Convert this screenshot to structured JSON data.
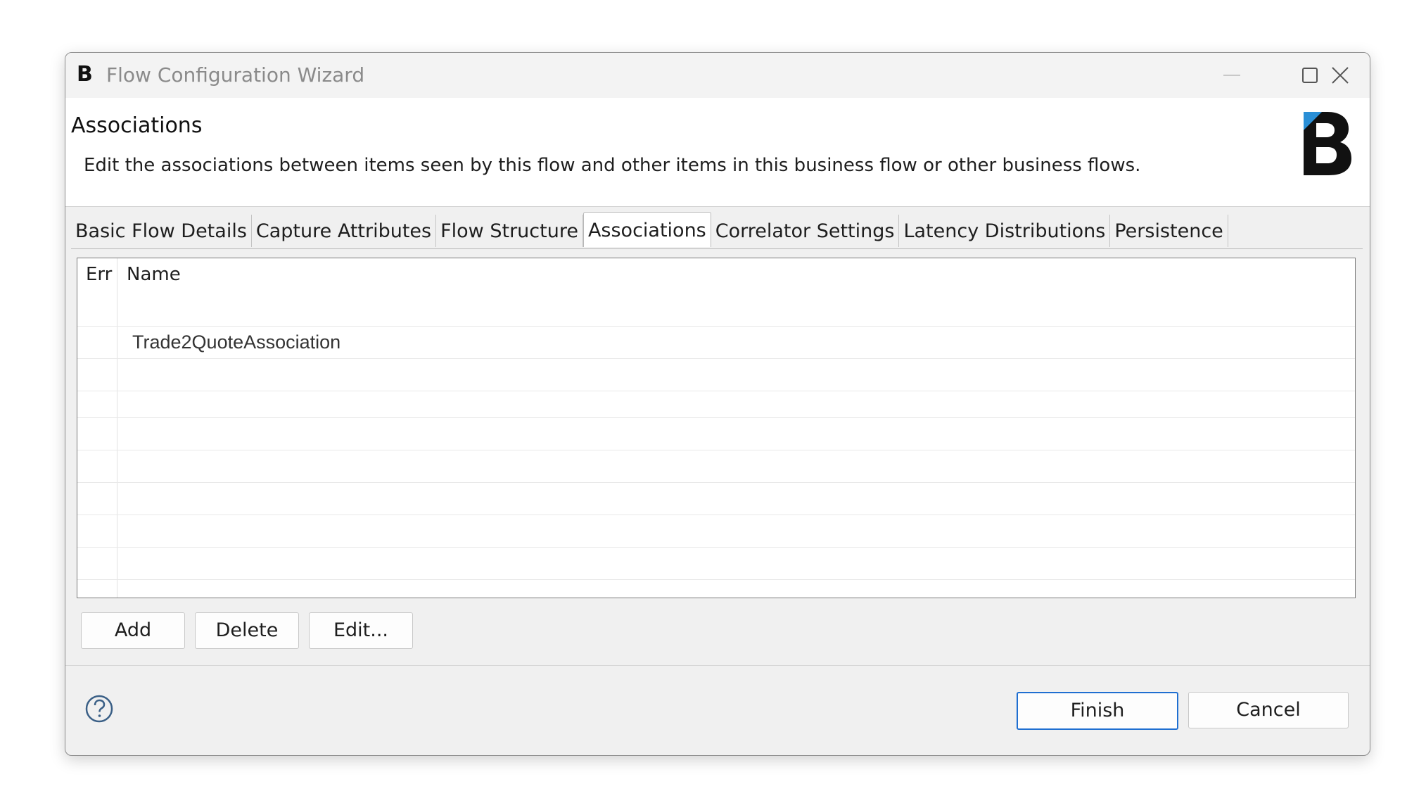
{
  "window": {
    "title": "Flow Configuration Wizard",
    "app_icon_letter": "B"
  },
  "header": {
    "title": "Associations",
    "description": "Edit the associations between items seen by this flow and other items in this business flow or other business flows.",
    "logo_icon": "brand-b-logo-icon"
  },
  "tabs": [
    {
      "label": "Basic Flow Details",
      "active": false
    },
    {
      "label": "Capture Attributes",
      "active": false
    },
    {
      "label": "Flow Structure",
      "active": false
    },
    {
      "label": "Associations",
      "active": true
    },
    {
      "label": "Correlator Settings",
      "active": false
    },
    {
      "label": "Latency Distributions",
      "active": false
    },
    {
      "label": "Persistence",
      "active": false
    }
  ],
  "table": {
    "columns": [
      "Err",
      "Name"
    ],
    "rows": [
      {
        "err": "",
        "name": "Trade2QuoteAssociation"
      }
    ]
  },
  "table_buttons": {
    "add": "Add",
    "delete": "Delete",
    "edit": "Edit..."
  },
  "footer": {
    "help_icon": "help-icon",
    "finish": "Finish",
    "cancel": "Cancel"
  },
  "colors": {
    "accent": "#1f6fd1",
    "logo_accent": "#2a8fd6"
  }
}
